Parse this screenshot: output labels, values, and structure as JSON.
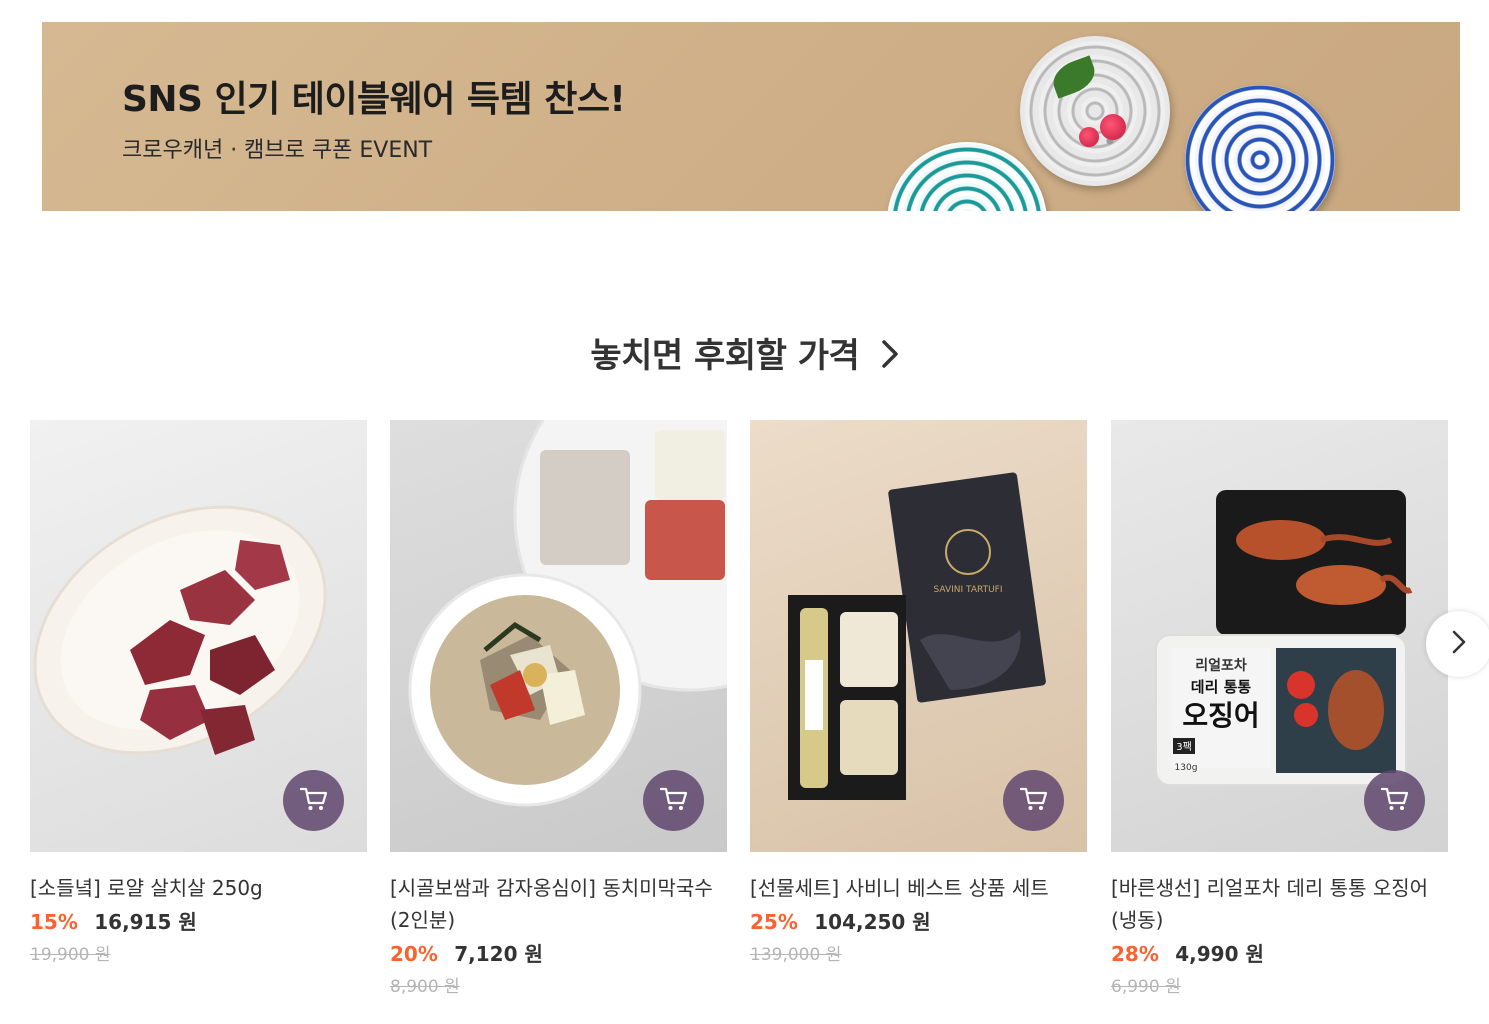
{
  "banner": {
    "title": "SNS 인기 테이블웨어 득템 찬스!",
    "subtitle": "크로우캐년 · 캠브로 쿠폰 EVENT"
  },
  "section": {
    "title": "놓치면 후회할 가격",
    "arrow_icon": "chevron-right-icon"
  },
  "products": [
    {
      "name": "[소들녘] 로얄 살치살 250g",
      "discount": "15%",
      "price": "16,915 원",
      "original_price": "19,900 원"
    },
    {
      "name": "[시골보쌈과 감자옹심이] 동치미막국수 (2인분)",
      "discount": "20%",
      "price": "7,120 원",
      "original_price": "8,900 원"
    },
    {
      "name": "[선물세트] 사비니 베스트 상품 세트",
      "discount": "25%",
      "price": "104,250 원",
      "original_price": "139,000 원"
    },
    {
      "name": "[바른생선] 리얼포차 데리 통통 오징어 (냉동)",
      "discount": "28%",
      "price": "4,990 원",
      "original_price": "6,990 원"
    }
  ],
  "product_images": {
    "box_brand": "SAVINI TARTUFI",
    "squid_pack_brand": "리얼포차",
    "squid_pack_subtitle": "데리 통통",
    "squid_pack_title": "오징어",
    "squid_pack_count": "3팩",
    "squid_pack_weight": "130g"
  },
  "colors": {
    "discount": "#fa622f",
    "cart_button": "#5f466e",
    "original_price": "#b5b5b5"
  },
  "icons": {
    "cart": "cart-icon",
    "next": "chevron-right-icon"
  }
}
